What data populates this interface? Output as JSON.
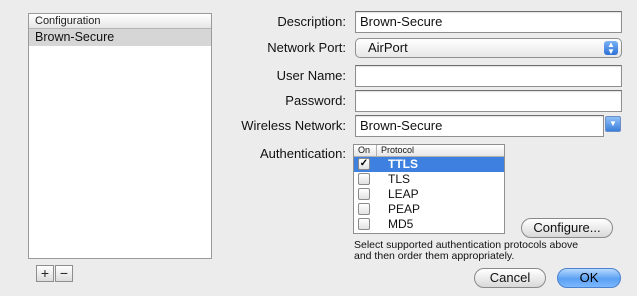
{
  "sidebar": {
    "header": "Configuration",
    "items": [
      {
        "label": "Brown-Secure"
      }
    ],
    "add_label": "+",
    "remove_label": "−"
  },
  "form": {
    "description": {
      "label": "Description:",
      "value": "Brown-Secure"
    },
    "network_port": {
      "label": "Network Port:",
      "value": "AirPort"
    },
    "user_name": {
      "label": "User Name:",
      "value": ""
    },
    "password": {
      "label": "Password:",
      "value": ""
    },
    "wireless_network": {
      "label": "Wireless Network:",
      "value": "Brown-Secure"
    },
    "authentication": {
      "label": "Authentication:",
      "col_on": "On",
      "col_protocol": "Protocol",
      "protocols": [
        {
          "name": "TTLS",
          "on": true,
          "selected": true
        },
        {
          "name": "TLS",
          "on": false,
          "selected": false
        },
        {
          "name": "LEAP",
          "on": false,
          "selected": false
        },
        {
          "name": "PEAP",
          "on": false,
          "selected": false
        },
        {
          "name": "MD5",
          "on": false,
          "selected": false
        }
      ],
      "configure_label": "Configure...",
      "hint_line1": "Select supported authentication protocols above",
      "hint_line2": "and then order them appropriately."
    }
  },
  "buttons": {
    "cancel": "Cancel",
    "ok": "OK"
  },
  "colors": {
    "selection": "#3d80df",
    "default_button": "#5aa0f3"
  }
}
